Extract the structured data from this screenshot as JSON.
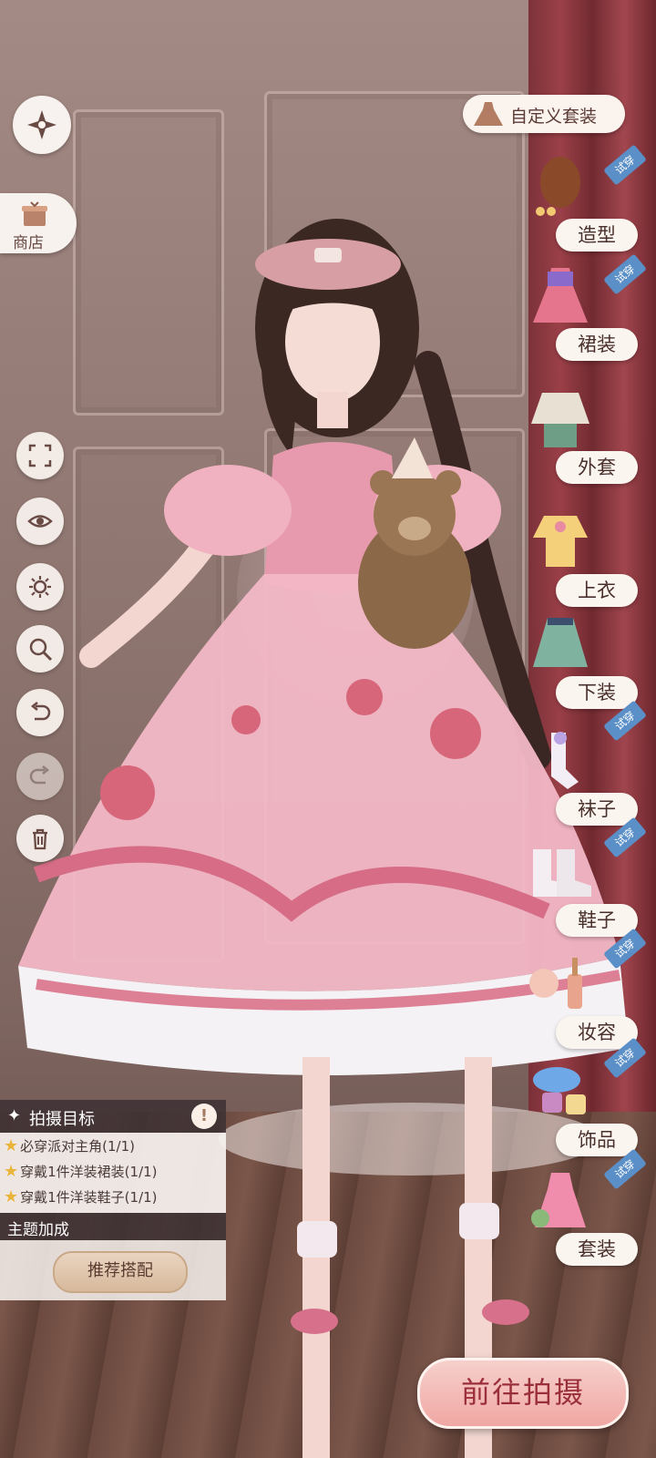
{
  "left_toolbar": {
    "shop_label": "商店",
    "icons": [
      "compass-back-icon",
      "frame-icon",
      "eye-icon",
      "light-icon",
      "zoom-icon",
      "undo-icon",
      "redo-icon",
      "trash-icon"
    ]
  },
  "right_menu": {
    "custom_label": "自定义套装",
    "categories": [
      {
        "label": "造型",
        "trial": "试穿"
      },
      {
        "label": "裙装",
        "trial": "试穿"
      },
      {
        "label": "外套",
        "trial": ""
      },
      {
        "label": "上衣",
        "trial": ""
      },
      {
        "label": "下装",
        "trial": ""
      },
      {
        "label": "袜子",
        "trial": "试穿"
      },
      {
        "label": "鞋子",
        "trial": "试穿"
      },
      {
        "label": "妆容",
        "trial": "试穿"
      },
      {
        "label": "饰品",
        "trial": "试穿"
      },
      {
        "label": "套装",
        "trial": "试穿"
      }
    ]
  },
  "objectives": {
    "title": "拍摄目标",
    "items": [
      "必穿派对主角(1/1)",
      "穿戴1件洋装裙装(1/1)",
      "穿戴1件洋装鞋子(1/1)"
    ],
    "bonus_title": "主题加成",
    "recommend_label": "推荐搭配"
  },
  "go_button": "前往拍摄",
  "colors": {
    "trial_badge": "#5a8fc8",
    "go_text": "#9a2f3a"
  }
}
